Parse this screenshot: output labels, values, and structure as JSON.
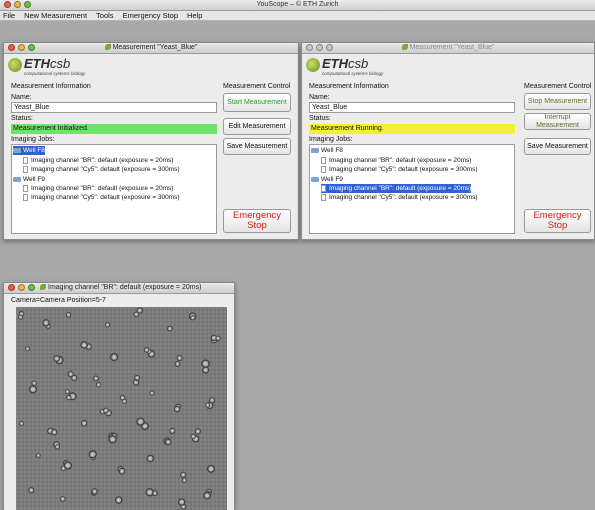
{
  "app": {
    "title": "YouScope – © ETH Zurich",
    "menu": [
      "File",
      "New Measurement",
      "Tools",
      "Emergency Stop",
      "Help"
    ]
  },
  "windows": [
    {
      "title": "Measurement \"Yeast_Blue\"",
      "logo": {
        "brand": "ETH",
        "brand2": "csb",
        "tagline": "computational systems biology"
      },
      "info_title": "Measurement Information",
      "name_label": "Name:",
      "name_value": "Yeast_Blue",
      "status_label": "Status:",
      "status_value": "Measurement Initialized.",
      "status_color": "#72e26f",
      "jobs_label": "Imaging Jobs:",
      "jobs": [
        {
          "well": "Well F8",
          "channels": [
            "Imaging channel \"BR\": default (exposure = 20ms)",
            "Imaging channel \"Cy5\": default (exposure = 300ms)"
          ]
        },
        {
          "well": "Well F9",
          "channels": [
            "Imaging channel \"BR\": default (exposure = 20ms)",
            "Imaging channel \"Cy5\": default (exposure = 300ms)"
          ]
        }
      ],
      "control_title": "Measurement Control",
      "buttons": [
        "Start Measurement",
        "Edit Measurement",
        "Save Measurement"
      ],
      "emergency": "Emergency Stop"
    },
    {
      "title": "Measurement \"Yeast_Blue\"",
      "logo": {
        "brand": "ETH",
        "brand2": "csb",
        "tagline": "computational systems biology"
      },
      "info_title": "Measurement Information",
      "name_label": "Name:",
      "name_value": "Yeast_Blue",
      "status_label": "Status:",
      "status_value": "Measurement Running.",
      "status_color": "#f3f03a",
      "jobs_label": "Imaging Jobs:",
      "jobs": [
        {
          "well": "Well F8",
          "channels": [
            "Imaging channel \"BR\": default (exposure = 20ms)",
            "Imaging channel \"Cy5\": default (exposure = 300ms)"
          ]
        },
        {
          "well": "Well F9",
          "channels": [
            "Imaging channel \"BR\": default (exposure = 20ms)",
            "Imaging channel \"Cy5\": default (exposure = 300ms)"
          ]
        }
      ],
      "control_title": "Measurement Control",
      "buttons": [
        "Stop Measurement",
        "Interrupt Measurement",
        "Save Measurement"
      ],
      "emergency": "Emergency Stop"
    }
  ],
  "camera_window": {
    "title": "Imaging channel \"BR\": default (exposure = 20ms)",
    "caption": "Camera=Camera Position=5-7"
  },
  "colors": {
    "selection": "#2f62d3",
    "emergency": "#d21b1b",
    "start": "#2a9d2a"
  }
}
